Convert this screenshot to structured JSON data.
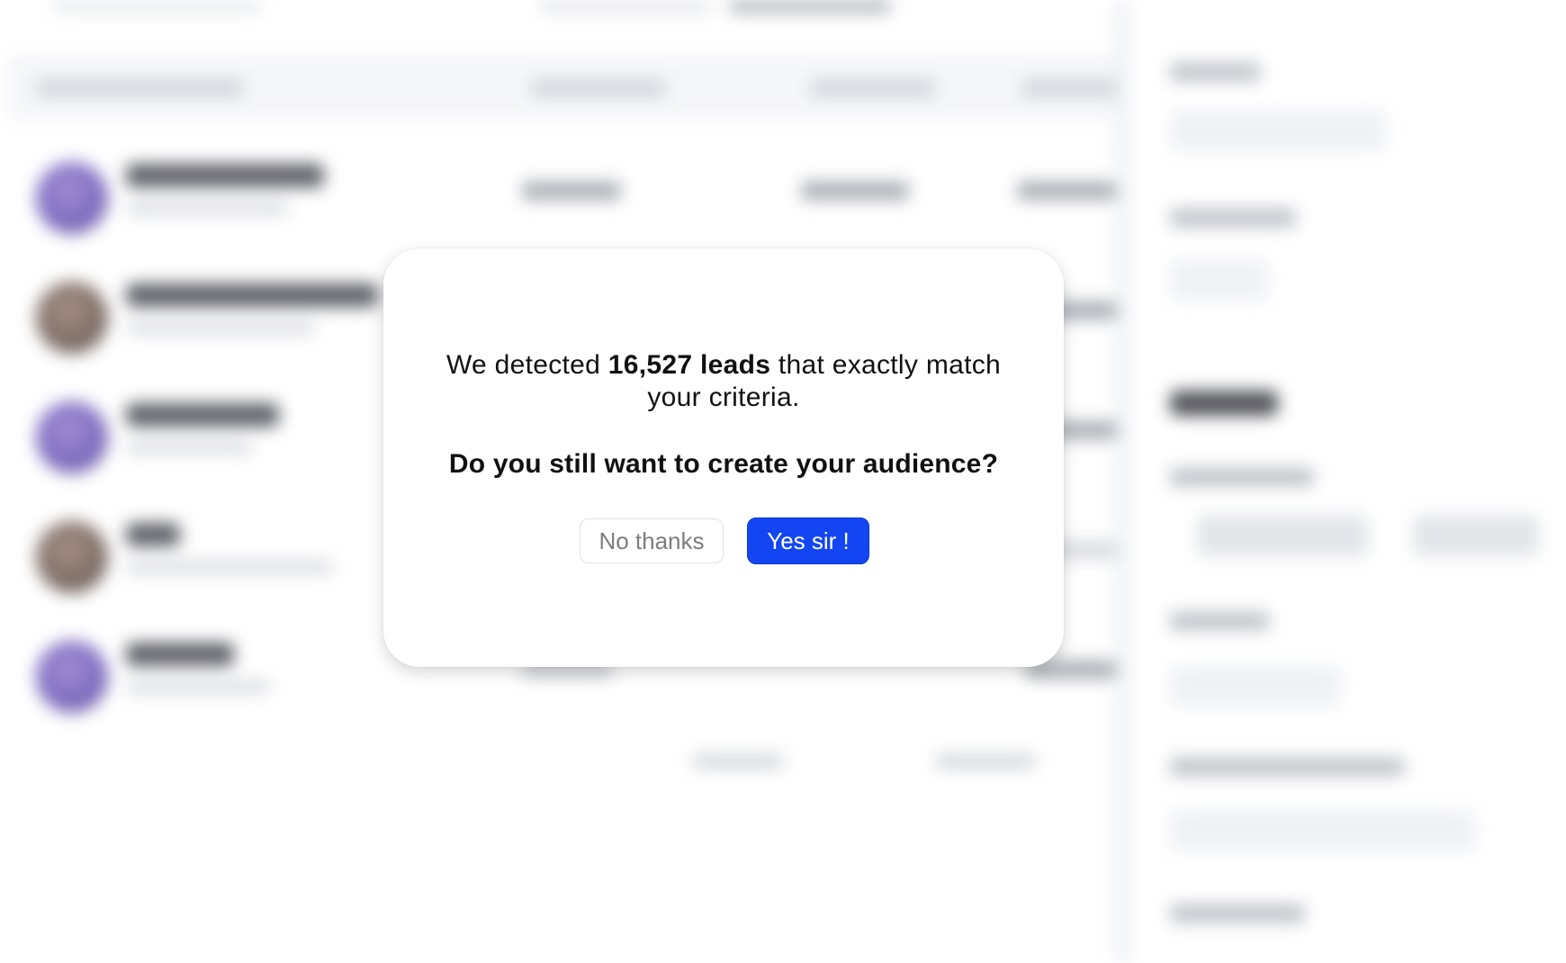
{
  "modal": {
    "message_prefix": "We detected",
    "leads_count": "16,527 leads",
    "message_suffix": "that exactly match your criteria.",
    "question": "Do you still want to create your audience?",
    "cancel_label": "No thanks",
    "confirm_label": "Yes sir !"
  },
  "colors": {
    "confirm_button": "#1346f2",
    "cancel_text": "#7d7d7d",
    "text": "#111111"
  }
}
